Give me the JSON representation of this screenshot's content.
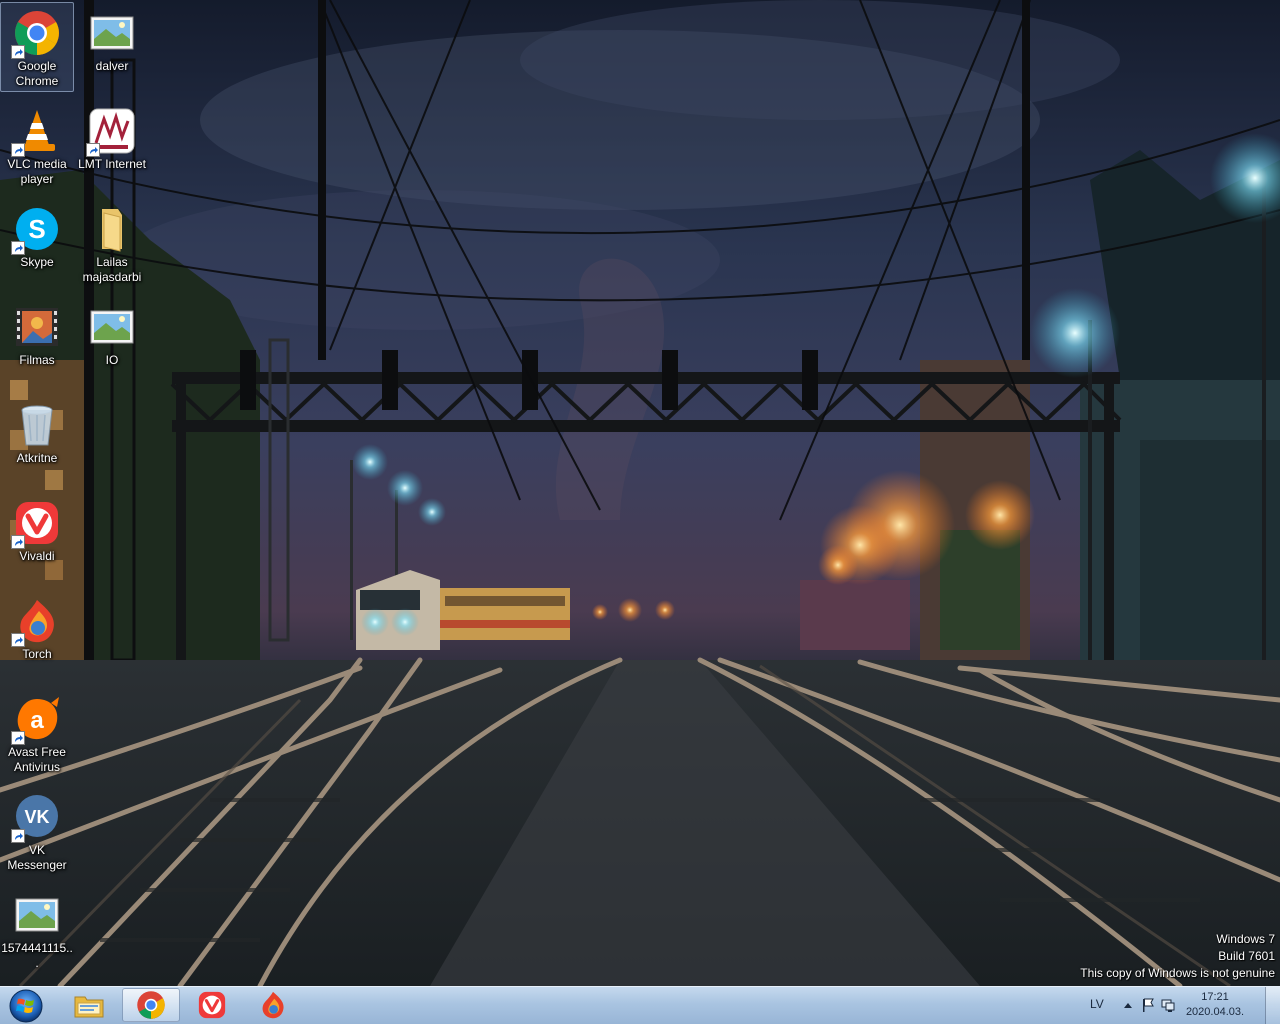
{
  "desktop": {
    "icons": [
      {
        "label": "Google Chrome",
        "icon": "chrome-icon",
        "shortcut": true,
        "selected": true
      },
      {
        "label": "dalver",
        "icon": "image-file-icon",
        "shortcut": false
      },
      {
        "label": "VLC media player",
        "icon": "vlc-icon",
        "shortcut": true
      },
      {
        "label": "LMT Internet",
        "icon": "lmt-internet-icon",
        "shortcut": true
      },
      {
        "label": "Skype",
        "icon": "skype-icon",
        "shortcut": true
      },
      {
        "label": "Lailas majasdarbi",
        "icon": "folder-icon",
        "shortcut": false
      },
      {
        "label": "Filmas",
        "icon": "video-folder-icon",
        "shortcut": false
      },
      {
        "label": "IO",
        "icon": "image-file-icon",
        "shortcut": false
      },
      {
        "label": "Atkritne",
        "icon": "recycle-bin-icon",
        "shortcut": false
      },
      {
        "label": "Vivaldi",
        "icon": "vivaldi-icon",
        "shortcut": true
      },
      {
        "label": "Torch",
        "icon": "torch-icon",
        "shortcut": true
      },
      {
        "label": "Avast Free Antivirus",
        "icon": "avast-icon",
        "shortcut": true
      },
      {
        "label": "VK Messenger",
        "icon": "vk-messenger-icon",
        "shortcut": true
      },
      {
        "label": "1574441115...",
        "icon": "image-file-icon",
        "shortcut": false
      }
    ]
  },
  "watermark": {
    "line1": "Windows 7",
    "line2": "Build 7601",
    "line3": "This copy of Windows is not genuine"
  },
  "taskbar": {
    "start_icon": "windows-logo-icon",
    "pinned": [
      {
        "name": "explorer",
        "icon": "file-explorer-icon",
        "active": false
      },
      {
        "name": "chrome",
        "icon": "chrome-icon",
        "active": true
      },
      {
        "name": "vivaldi",
        "icon": "vivaldi-icon",
        "active": false
      },
      {
        "name": "torch",
        "icon": "torch-icon",
        "active": false
      }
    ],
    "tray": {
      "language": "LV",
      "icons": [
        "show-hidden-icons-icon",
        "action-center-flag-icon",
        "network-icon"
      ],
      "time": "17:21",
      "date": "2020.04.03."
    }
  },
  "colors": {
    "taskbar": "#a9c4e1",
    "chrome_red": "#db4437",
    "chrome_green": "#0f9d58",
    "chrome_yellow": "#f4b400",
    "chrome_blue": "#4285f4",
    "vlc_orange": "#f08a00",
    "skype_blue": "#00aff0",
    "vivaldi_red": "#ef3939",
    "avast_orange": "#ff7800",
    "vk_blue": "#4a76a8"
  }
}
